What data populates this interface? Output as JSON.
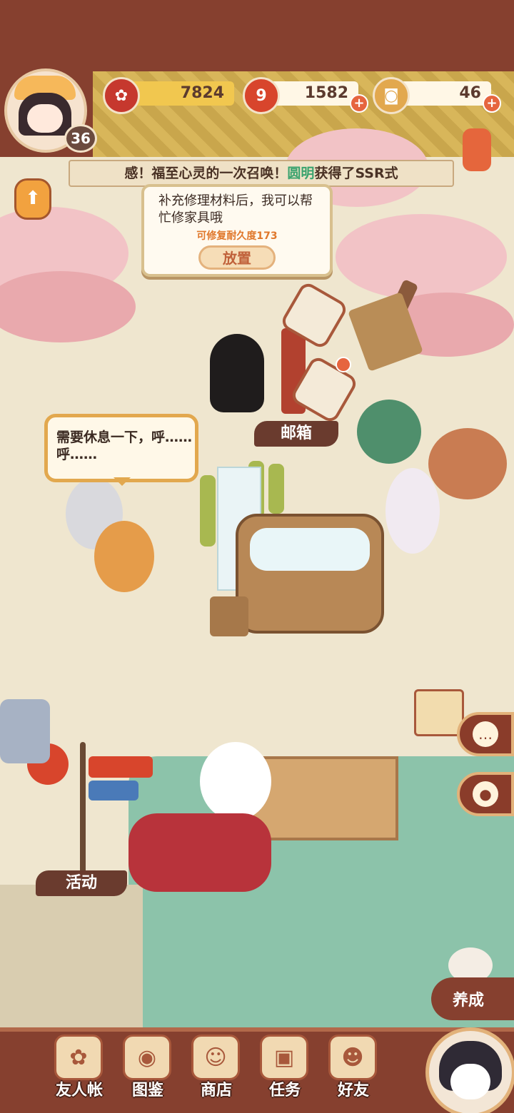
{
  "player": {
    "level": "36"
  },
  "resources": {
    "gold": "7824",
    "jade": "1582",
    "coins": "46"
  },
  "ticker": {
    "prefix": "感！福至心灵的一次召唤！",
    "highlight": "圆明",
    "suffix": "获得了SSR式"
  },
  "repair_tip": {
    "message": "补充修理材料后，我可以帮忙修家具哦",
    "durability": "可修复耐久度173",
    "button": "放置"
  },
  "speech_bubble": {
    "text": "需要休息一下，呼……呼……"
  },
  "labels": {
    "mailbox": "邮箱",
    "event": "活动",
    "nurture": "养成"
  },
  "bottom_nav": [
    {
      "label": "友人帐",
      "icon": "friend-book-icon"
    },
    {
      "label": "图鉴",
      "icon": "eye-book-icon"
    },
    {
      "label": "商店",
      "icon": "lucky-cat-shop-icon"
    },
    {
      "label": "任务",
      "icon": "task-box-icon"
    },
    {
      "label": "好友",
      "icon": "friends-icon"
    }
  ],
  "colors": {
    "frame": "#86402f",
    "accent_orange": "#e0782c",
    "highlight_green": "#3aa36e"
  }
}
